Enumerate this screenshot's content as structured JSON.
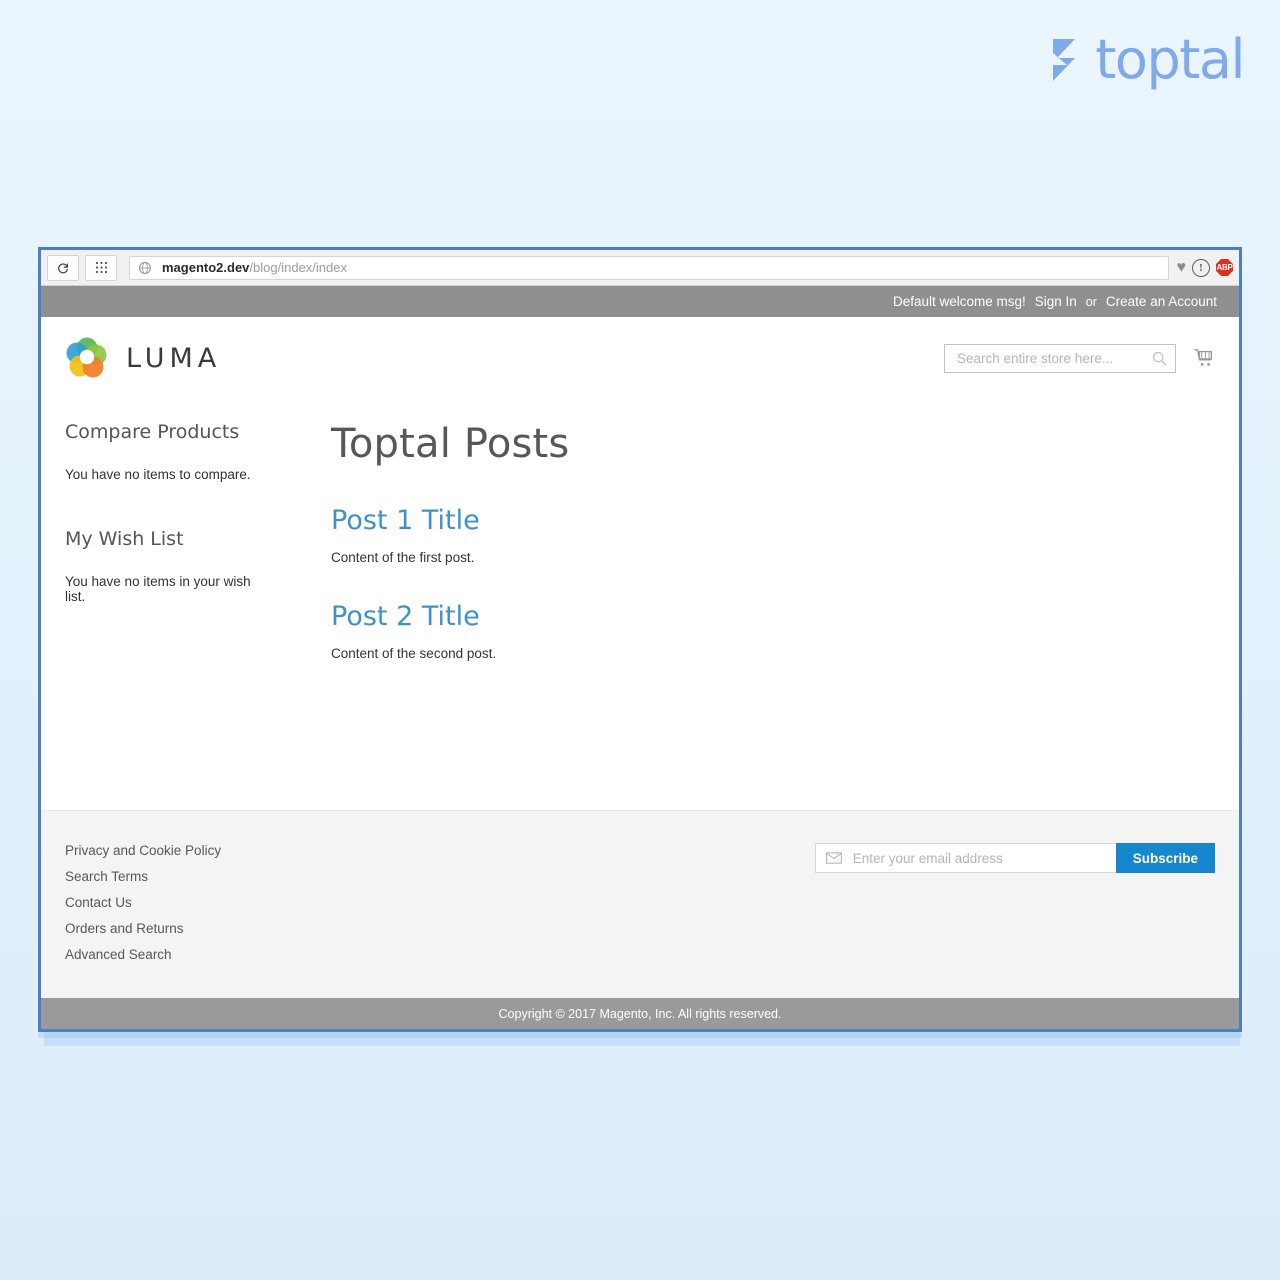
{
  "watermark": {
    "brand": "toptal",
    "mark_icon": "toptal-chevron-icon",
    "color": "#7fa9e8"
  },
  "browser": {
    "toolbar": {
      "reload_icon": "reload-icon",
      "apps_grid_icon": "apps-grid-icon",
      "site_icon": "globe-icon",
      "url_domain": "magento2.dev",
      "url_path": "/blog/index/index",
      "extensions": [
        {
          "name": "heart-icon",
          "label": "♥"
        },
        {
          "name": "info-circle-icon",
          "label": "!"
        },
        {
          "name": "adblock-plus-icon",
          "label": "ABP"
        }
      ]
    },
    "border_color": "#4a7fc1"
  },
  "panel_header": {
    "welcome_message": "Default welcome msg!",
    "sign_in_label": "Sign In",
    "or_label": "or",
    "create_account_label": "Create an Account",
    "background": "#8f8f8f"
  },
  "store_header": {
    "logo_icon": "luma-flower-logo-icon",
    "brand_name": "LUMA",
    "search": {
      "placeholder": "Search entire store here...",
      "value": "",
      "icon": "search-icon"
    },
    "cart_icon": "shopping-cart-icon"
  },
  "sidebar": {
    "blocks": [
      {
        "title": "Compare Products",
        "text": "You have no items to compare."
      },
      {
        "title": "My Wish List",
        "text": "You have no items in your wish list."
      }
    ]
  },
  "main": {
    "page_title": "Toptal Posts",
    "posts": [
      {
        "title": "Post 1 Title",
        "body": "Content of the first post."
      },
      {
        "title": "Post 2 Title",
        "body": "Content of the second post."
      }
    ],
    "link_color": "#3f93c4"
  },
  "footer": {
    "links": [
      "Privacy and Cookie Policy",
      "Search Terms",
      "Contact Us",
      "Orders and Returns",
      "Advanced Search"
    ],
    "newsletter": {
      "mail_icon": "envelope-icon",
      "placeholder": "Enter your email address",
      "value": "",
      "subscribe_label": "Subscribe",
      "button_color": "#1787cd"
    },
    "copyright": "Copyright © 2017 Magento, Inc. All rights reserved."
  }
}
